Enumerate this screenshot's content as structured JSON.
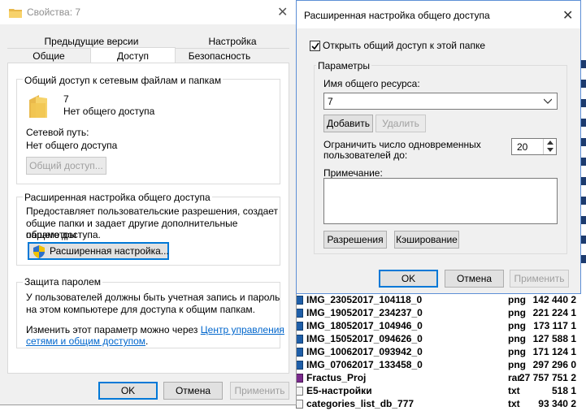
{
  "props": {
    "title": "Свойства: 7",
    "tabs_top": [
      "Предыдущие версии",
      "Настройка"
    ],
    "tabs_bottom": [
      "Общие",
      "Доступ",
      "Безопасность"
    ],
    "net": {
      "legend": "Общий доступ к сетевым файлам и папкам",
      "name": "7",
      "status": "Нет общего доступа",
      "path_label": "Сетевой путь:",
      "path_value": "Нет общего доступа",
      "share_btn": "Общий доступ..."
    },
    "adv": {
      "legend": "Расширенная настройка общего доступа",
      "desc1": "Предоставляет пользовательские разрешения, создает",
      "desc2": "общие папки и задает другие дополнительные параметры",
      "desc3": "общего доступа.",
      "btn": "Расширенная настройка..."
    },
    "pwd": {
      "legend": "Защита паролем",
      "desc1": "У пользователей должны быть учетная запись и пароль",
      "desc2": "на этом компьютере для доступа к общим папкам.",
      "change1": "Изменить этот параметр можно через",
      "link1": "Центр управления",
      "link2": "сетями и общим доступом",
      "dot": "."
    },
    "ok": "OK",
    "cancel": "Отмена",
    "apply": "Применить"
  },
  "adv_dialog": {
    "title": "Расширенная настройка общего доступа",
    "share_checkbox": "Открыть общий доступ к этой папке",
    "share_checked": true,
    "params_label": "Параметры",
    "share_name_label": "Имя общего ресурса:",
    "share_name_value": "7",
    "add_btn": "Добавить",
    "remove_btn": "Удалить",
    "limit_label1": "Ограничить число одновременных",
    "limit_label2": "пользователей до:",
    "limit_value": "20",
    "note_label": "Примечание:",
    "perm_btn": "Разрешения",
    "cache_btn": "Кэширование",
    "ok": "OK",
    "cancel": "Отмена",
    "apply": "Применить"
  },
  "file_list": [
    {
      "name": "IMG_23052017_104118_0",
      "type": "png",
      "size": "142 440 2"
    },
    {
      "name": "IMG_19052017_234237_0",
      "type": "png",
      "size": "221 224 1"
    },
    {
      "name": "IMG_18052017_104946_0",
      "type": "png",
      "size": "173 117 1"
    },
    {
      "name": "IMG_15052017_094626_0",
      "type": "png",
      "size": "127 588 1"
    },
    {
      "name": "IMG_10062017_093942_0",
      "type": "png",
      "size": "171 124 1"
    },
    {
      "name": "IMG_07062017_133458_0",
      "type": "png",
      "size": "297 296 0"
    },
    {
      "name": "Fractus_Proj",
      "type": "rar",
      "size": "27 757 751 2"
    },
    {
      "name": "E5-настройки",
      "type": "txt",
      "size": "518 1"
    },
    {
      "name": "categories_list_db_777",
      "type": "txt",
      "size": "93 340 2"
    }
  ],
  "colors": {
    "accent": "#0078d7",
    "link": "#0066cc",
    "file_icon": "#1e5ea8"
  }
}
